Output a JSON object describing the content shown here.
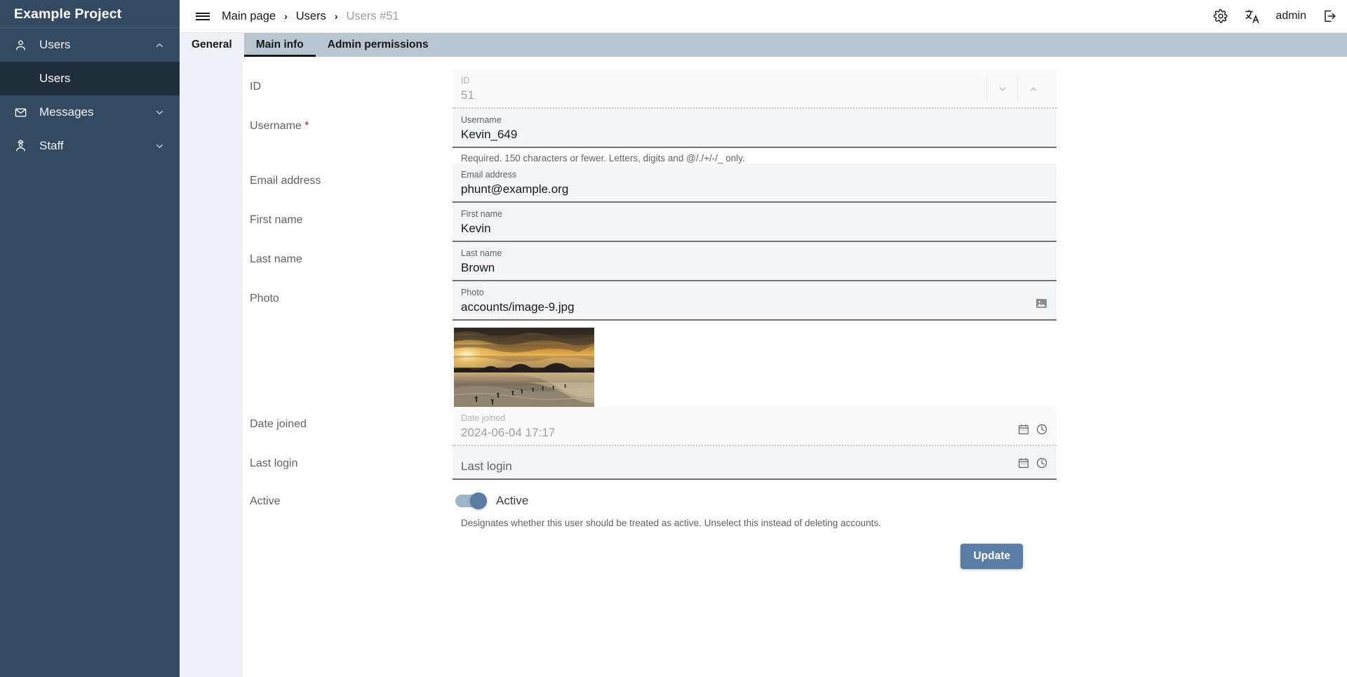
{
  "sidebar": {
    "brand": "Example Project",
    "items": [
      {
        "label": "Users",
        "icon": "user-icon",
        "expanded": true,
        "chevron": "chevron-up-icon"
      },
      {
        "label": "Messages",
        "icon": "mail-icon",
        "expanded": false,
        "chevron": "chevron-down-icon"
      },
      {
        "label": "Staff",
        "icon": "staff-icon",
        "expanded": false,
        "chevron": "chevron-down-icon"
      }
    ],
    "submenu": {
      "label": "Users",
      "parent": "Users",
      "selected": true
    }
  },
  "topbar": {
    "menu_icon": "hamburger-menu-icon",
    "breadcrumb": [
      {
        "label": "Main page",
        "current": false
      },
      {
        "label": "Users",
        "current": false
      },
      {
        "label": "Users #51",
        "current": true
      }
    ],
    "separator": "›",
    "settings_icon": "gear-icon",
    "language_icon": "translate-icon",
    "username": "admin",
    "logout_icon": "logout-icon"
  },
  "tabs": [
    {
      "label": "General",
      "active": false,
      "style": "light"
    },
    {
      "label": "Main info",
      "active": true,
      "style": "plain"
    },
    {
      "label": "Admin permissions",
      "active": false,
      "style": "plain"
    }
  ],
  "form": {
    "fields": [
      {
        "name": "id",
        "row_label": "ID",
        "required": false,
        "field_label": "ID",
        "value": "51",
        "disabled": true,
        "help": "",
        "adornments": [
          "chevron-down-icon",
          "chevron-up-icon"
        ]
      },
      {
        "name": "username",
        "row_label": "Username",
        "required": true,
        "field_label": "Username",
        "value": "Kevin_649",
        "disabled": false,
        "help": "Required. 150 characters or fewer. Letters, digits and @/./+/-/_ only.",
        "adornments": []
      },
      {
        "name": "email",
        "row_label": "Email address",
        "required": false,
        "field_label": "Email address",
        "value": "phunt@example.org",
        "disabled": false,
        "help": "",
        "adornments": []
      },
      {
        "name": "first-name",
        "row_label": "First name",
        "required": false,
        "field_label": "First name",
        "value": "Kevin",
        "disabled": false,
        "help": "",
        "adornments": []
      },
      {
        "name": "last-name",
        "row_label": "Last name",
        "required": false,
        "field_label": "Last name",
        "value": "Brown",
        "disabled": false,
        "help": "",
        "adornments": []
      },
      {
        "name": "photo",
        "row_label": "Photo",
        "required": false,
        "field_label": "Photo",
        "value": "accounts/image-9.jpg",
        "disabled": false,
        "help": "",
        "adornments": [
          "image-icon"
        ],
        "thumbnail": "beach-sunset-photo"
      },
      {
        "name": "date-joined",
        "row_label": "Date joined",
        "required": false,
        "field_label": "Date joined",
        "value": "2024-06-04 17:17",
        "disabled": true,
        "help": "",
        "adornments": [
          "calendar-icon",
          "clock-icon"
        ]
      },
      {
        "name": "last-login",
        "row_label": "Last login",
        "required": false,
        "field_label": "",
        "value": "",
        "placeholder": "Last login",
        "disabled": false,
        "help": "",
        "adornments": [
          "calendar-icon",
          "clock-icon"
        ]
      }
    ],
    "active_field": {
      "row_label": "Active",
      "toggle_label": "Active",
      "checked": true,
      "help": "Designates whether this user should be treated as active. Unselect this instead of deleting accounts."
    },
    "submit_label": "Update"
  },
  "colors": {
    "sidebar_bg": "#344a61",
    "sidebar_sub_bg": "#1f2d3d",
    "tabbar_bg": "#b9c5d1",
    "gutter_bg": "#eef1f5",
    "primary": "#5a7ca5",
    "field_bg": "#f4f5f7",
    "required_asterisk": "#b3261e"
  }
}
